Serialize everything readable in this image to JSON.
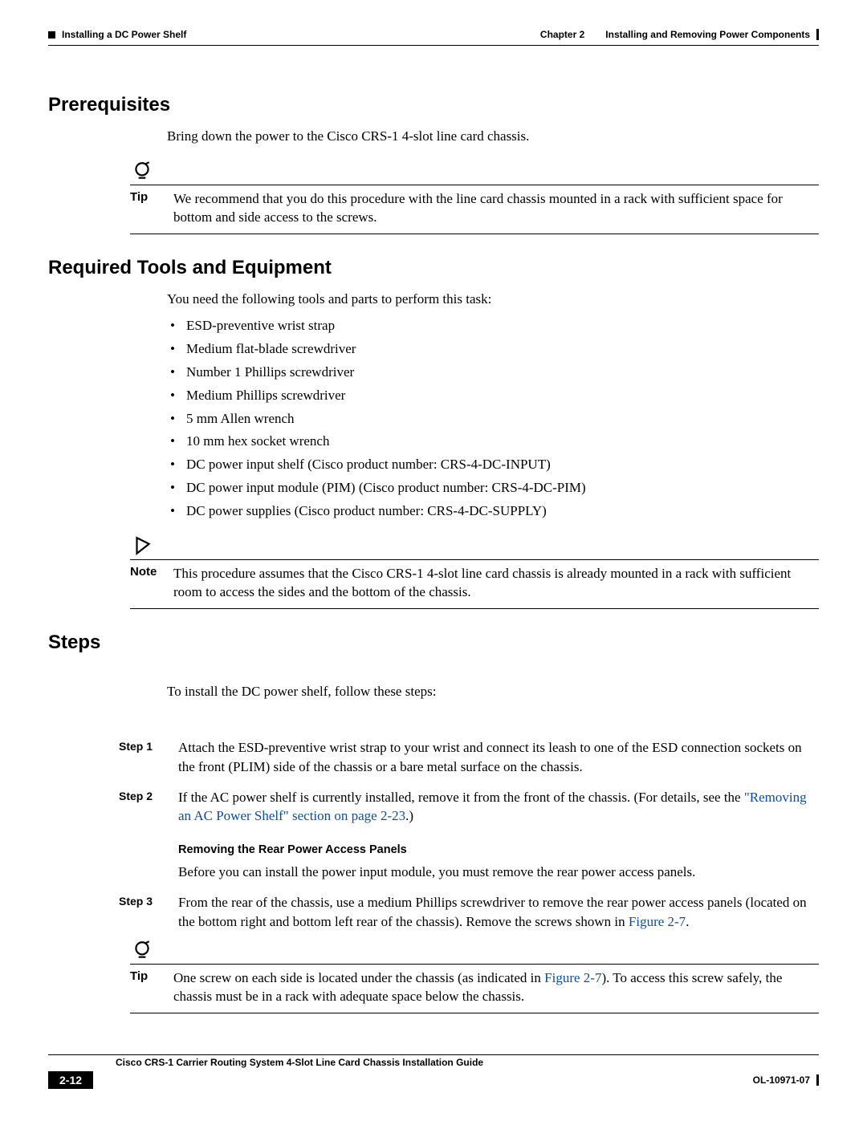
{
  "header": {
    "section_title": "Installing a DC Power Shelf",
    "chapter_label": "Chapter 2",
    "chapter_title": "Installing and Removing Power Components"
  },
  "prereq": {
    "heading": "Prerequisites",
    "body": "Bring down the power to the Cisco CRS-1 4-slot line card chassis.",
    "tip_label": "Tip",
    "tip_text": "We recommend that you do this procedure with the line card chassis mounted in a rack with sufficient space for bottom and side access to the screws."
  },
  "tools": {
    "heading": "Required Tools and Equipment",
    "intro": "You need the following tools and parts to perform this task:",
    "items": [
      "ESD-preventive wrist strap",
      "Medium flat-blade screwdriver",
      "Number 1 Phillips screwdriver",
      "Medium Phillips screwdriver",
      "5 mm Allen wrench",
      "10 mm hex socket wrench",
      "DC power input shelf (Cisco product number: CRS-4-DC-INPUT)",
      "DC power input module (PIM) (Cisco product number: CRS-4-DC-PIM)",
      "DC power supplies (Cisco product number: CRS-4-DC-SUPPLY)"
    ],
    "note_label": "Note",
    "note_text": "This procedure assumes that the Cisco CRS-1 4-slot line card chassis is already mounted in a rack with sufficient room to access the sides and the bottom of the chassis."
  },
  "steps": {
    "heading": "Steps",
    "intro": "To install the DC power shelf, follow these steps:",
    "s1_label": "Step 1",
    "s1_text": "Attach the ESD-preventive wrist strap to your wrist and connect its leash to one of the ESD connection sockets on the front (PLIM) side of the chassis or a bare metal surface on the chassis.",
    "s2_label": "Step 2",
    "s2_text_a": "If the AC power shelf is currently installed, remove it from the front of the chassis. (For details, see the ",
    "s2_link": "\"Removing an AC Power Shelf\" section on page 2-23",
    "s2_text_b": ".)",
    "sub_heading": "Removing the Rear Power Access Panels",
    "sub_body": "Before you can install the power input module, you must remove the rear power access panels.",
    "s3_label": "Step 3",
    "s3_text_a": "From the rear of the chassis, use a medium Phillips screwdriver to remove the rear power access panels (located on the bottom right and bottom left rear of the chassis). Remove the screws shown in ",
    "s3_link": "Figure 2-7",
    "s3_text_b": ".",
    "tip2_label": "Tip",
    "tip2_text_a": "One screw on each side is located under the chassis (as indicated in ",
    "tip2_link": "Figure 2-7",
    "tip2_text_b": "). To access this screw safely, the chassis must be in a rack with adequate space below the chassis."
  },
  "footer": {
    "guide_title": "Cisco CRS-1 Carrier Routing System 4-Slot Line Card Chassis Installation Guide",
    "page_number": "2-12",
    "doc_id": "OL-10971-07"
  }
}
